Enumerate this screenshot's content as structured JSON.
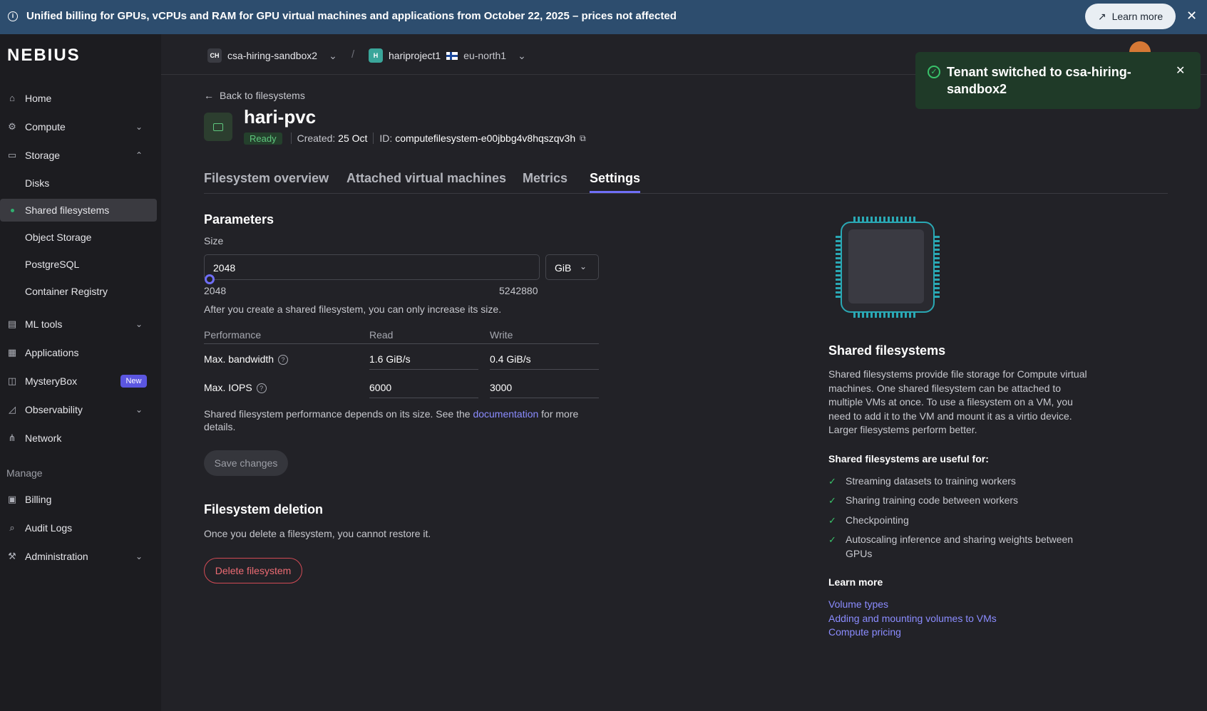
{
  "banner": {
    "text": "Unified billing for GPUs, vCPUs and RAM for GPU virtual machines and applications from October 22, 2025 – prices not affected",
    "learn_more": "Learn more"
  },
  "brand": "NEBIUS",
  "sidebar": {
    "items": [
      {
        "label": "Home"
      },
      {
        "label": "Compute"
      },
      {
        "label": "Storage"
      },
      {
        "label": "Disks"
      },
      {
        "label": "Shared filesystems"
      },
      {
        "label": "Object Storage"
      },
      {
        "label": "PostgreSQL"
      },
      {
        "label": "Container Registry"
      },
      {
        "label": "ML tools"
      },
      {
        "label": "Applications"
      },
      {
        "label": "MysteryBox",
        "badge": "New"
      },
      {
        "label": "Observability"
      },
      {
        "label": "Network"
      },
      {
        "label": "Billing"
      },
      {
        "label": "Audit Logs"
      },
      {
        "label": "Administration"
      }
    ],
    "manage_heading": "Manage"
  },
  "topbar": {
    "tenant_initials": "CH",
    "tenant": "csa-hiring-sandbox2",
    "project_initial": "H",
    "project": "hariproject1",
    "region": "eu-north1"
  },
  "toast": {
    "message": "Tenant switched to csa-hiring-sandbox2"
  },
  "page": {
    "back": "Back to filesystems",
    "title": "hari-pvc",
    "status": "Ready",
    "created_label": "Created:",
    "created_value": "25 Oct",
    "id_label": "ID:",
    "id_value": "computefilesystem-e00jbbg4v8hqszqv3h"
  },
  "tabs": [
    "Filesystem overview",
    "Attached virtual machines",
    "Metrics",
    "Settings"
  ],
  "params": {
    "heading": "Parameters",
    "size_label": "Size",
    "size_value": "2048",
    "unit": "GiB",
    "min": "2048",
    "max": "5242880",
    "slider_fraction": 0.0,
    "note": "After you create a shared filesystem, you can only increase its size.",
    "perf_header": "Performance",
    "read_header": "Read",
    "write_header": "Write",
    "rows": [
      {
        "label": "Max. bandwidth",
        "read": "1.6 GiB/s",
        "write": "0.4 GiB/s"
      },
      {
        "label": "Max. IOPS",
        "read": "6000",
        "write": "3000"
      }
    ],
    "perf_note_a": "Shared filesystem performance depends on its size. See the ",
    "perf_note_link": "documentation",
    "perf_note_b": " for more details.",
    "save": "Save changes"
  },
  "deletion": {
    "heading": "Filesystem deletion",
    "note": "Once you delete a filesystem, you cannot restore it.",
    "button": "Delete filesystem"
  },
  "info": {
    "title": "Shared filesystems",
    "description": "Shared filesystems provide file storage for Compute virtual machines. One shared filesystem can be attached to multiple VMs at once. To use a filesystem on a VM, you need to add it to the VM and mount it as a virtio device. Larger filesystems perform better.",
    "useful_heading": "Shared filesystems are useful for:",
    "useful": [
      "Streaming datasets to training workers",
      "Sharing training code between workers",
      "Checkpointing",
      "Autoscaling inference and sharing weights between GPUs"
    ],
    "learn_heading": "Learn more",
    "links": [
      "Volume types",
      "Adding and mounting volumes to VMs",
      "Compute pricing"
    ]
  },
  "colors": {
    "accent": "#6f6ef7",
    "success": "#5fc77e",
    "danger": "#ec6b73",
    "link": "#8b8cff",
    "banner": "#2d4d6e"
  }
}
